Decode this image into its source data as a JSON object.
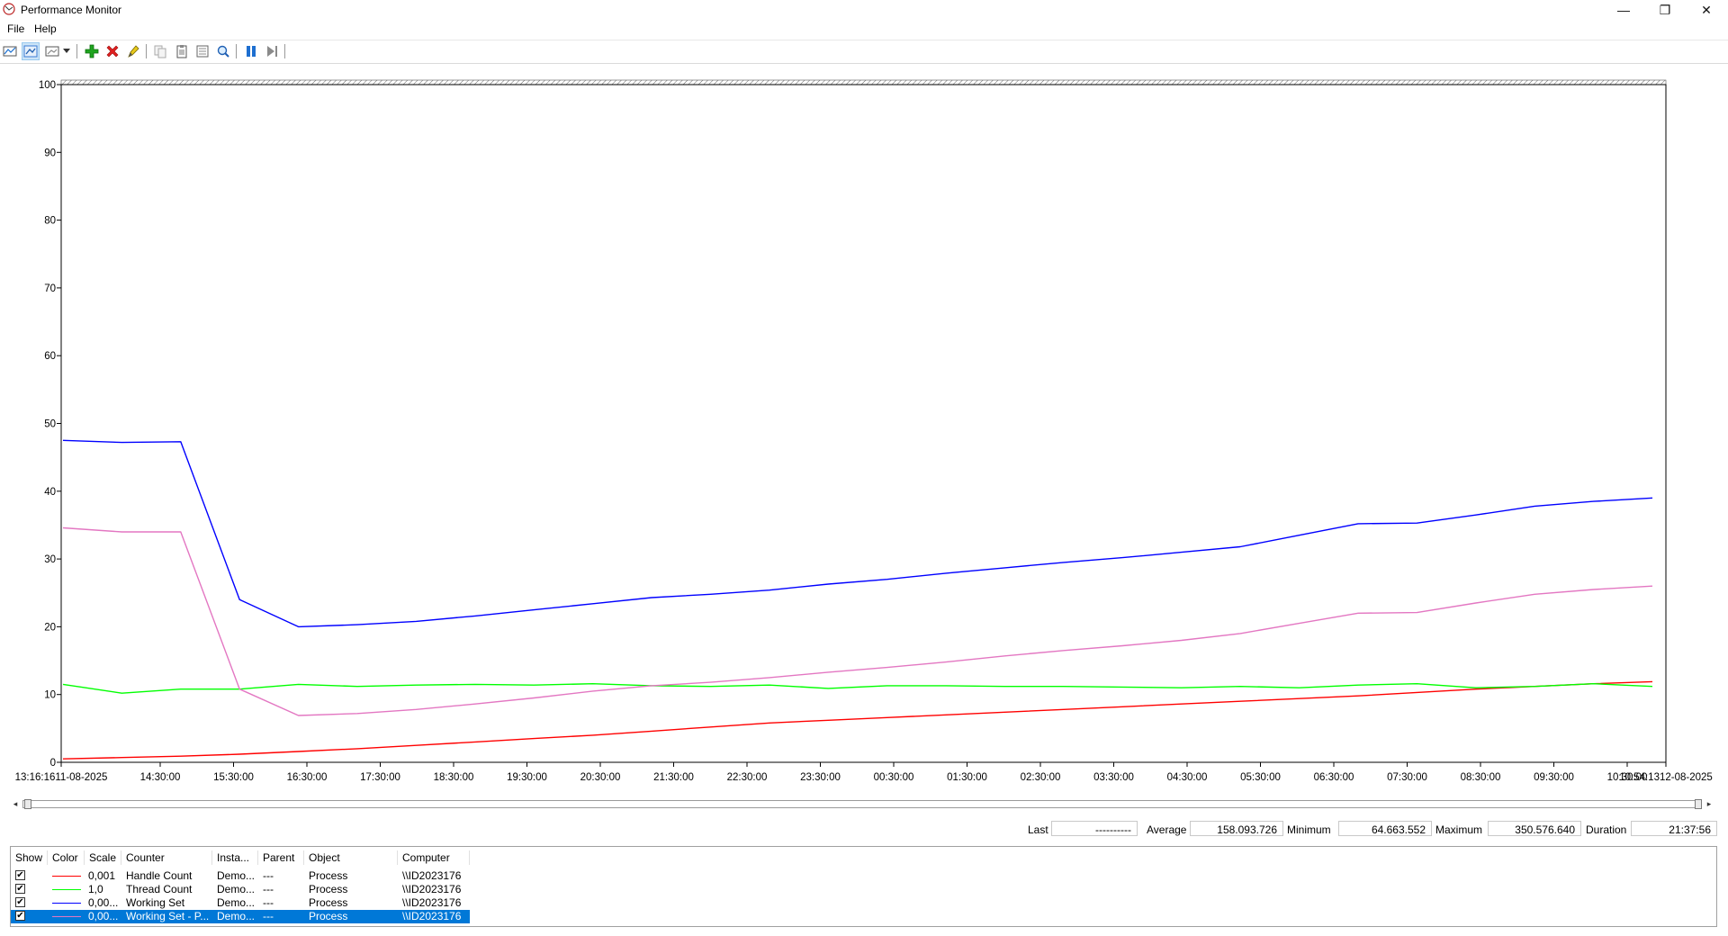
{
  "window": {
    "title": "Performance Monitor",
    "controls": {
      "minimize": "—",
      "restore": "❐",
      "close": "✕"
    }
  },
  "menu": {
    "file_label": "File",
    "help_label": "Help"
  },
  "toolbar": {
    "icons": [
      "view-current-activity-icon",
      "view-log-data-icon",
      "change-graph-type-icon",
      "dropdown-icon",
      "add-counter-icon",
      "delete-counter-icon",
      "highlight-icon",
      "copy-properties-icon",
      "paste-counter-list-icon",
      "properties-icon",
      "zoom-icon",
      "freeze-display-icon",
      "update-data-icon"
    ]
  },
  "colors": {
    "handle_count": "#ff0000",
    "thread_count": "#00ff00",
    "working_set": "#0000ff",
    "working_set_private": "#e377c2",
    "selection": "#0078d7"
  },
  "chart_data": {
    "type": "line",
    "ylim": [
      0,
      100
    ],
    "y_ticks": [
      "0",
      "10",
      "20",
      "30",
      "40",
      "50",
      "60",
      "70",
      "80",
      "90",
      "100"
    ],
    "x_tick_labels": [
      "13:16:1611-08-2025",
      "14:30:00",
      "15:30:00",
      "16:30:00",
      "17:30:00",
      "18:30:00",
      "19:30:00",
      "20:30:00",
      "21:30:00",
      "22:30:00",
      "23:30:00",
      "00:30:00",
      "01:30:00",
      "02:30:00",
      "03:30:00",
      "04:30:00",
      "05:30:00",
      "06:30:00",
      "07:30:00",
      "08:30:00",
      "09:30:00",
      "10:30:00",
      "10:54:1312-08-2025"
    ],
    "grid": false,
    "series": [
      {
        "name": "Handle Count",
        "color": "#ff0000",
        "values": [
          0.5,
          0.7,
          0.9,
          1.2,
          1.6,
          2.0,
          2.5,
          3.0,
          3.5,
          4.0,
          4.6,
          5.2,
          5.8,
          6.2,
          6.6,
          7.0,
          7.4,
          7.8,
          8.2,
          8.6,
          9.0,
          9.4,
          9.8,
          10.3,
          10.8,
          11.2,
          11.6,
          11.9
        ]
      },
      {
        "name": "Thread Count",
        "color": "#00ff00",
        "values": [
          11.5,
          10.2,
          10.8,
          10.8,
          11.5,
          11.2,
          11.4,
          11.5,
          11.4,
          11.6,
          11.3,
          11.2,
          11.4,
          10.9,
          11.3,
          11.3,
          11.2,
          11.2,
          11.1,
          11.0,
          11.2,
          11.0,
          11.4,
          11.6,
          11.0,
          11.2,
          11.6,
          11.2
        ]
      },
      {
        "name": "Working Set",
        "color": "#0000ff",
        "values": [
          47.5,
          47.2,
          47.3,
          24.0,
          20.0,
          20.3,
          20.8,
          21.6,
          22.5,
          23.4,
          24.3,
          24.8,
          25.4,
          26.3,
          27.0,
          27.9,
          28.7,
          29.5,
          30.2,
          31.0,
          31.8,
          33.5,
          35.2,
          35.3,
          36.5,
          37.8,
          38.5,
          39.0
        ]
      },
      {
        "name": "Working Set - Private",
        "color": "#e377c2",
        "values": [
          34.6,
          34.0,
          34.0,
          10.8,
          6.9,
          7.2,
          7.8,
          8.6,
          9.5,
          10.5,
          11.3,
          11.8,
          12.5,
          13.3,
          14.0,
          14.8,
          15.7,
          16.5,
          17.2,
          18.0,
          19.0,
          20.5,
          22.0,
          22.1,
          23.5,
          24.8,
          25.5,
          26.0
        ]
      }
    ]
  },
  "stats": {
    "last_label": "Last",
    "last_value": "----------",
    "average_label": "Average",
    "average_value": "158.093.726",
    "minimum_label": "Minimum",
    "minimum_value": "64.663.552",
    "maximum_label": "Maximum",
    "maximum_value": "350.576.640",
    "duration_label": "Duration",
    "duration_value": "21:37:56"
  },
  "legend": {
    "headers": [
      "Show",
      "Color",
      "Scale",
      "Counter",
      "Insta...",
      "Parent",
      "Object",
      "Computer"
    ],
    "rows": [
      {
        "checked": "✔",
        "color": "#ff0000",
        "scale": "0,001",
        "counter": "Handle Count",
        "instance": "Demo...",
        "parent": "---",
        "object": "Process",
        "computer": "\\\\ID2023176"
      },
      {
        "checked": "✔",
        "color": "#00ff00",
        "scale": "1,0",
        "counter": "Thread Count",
        "instance": "Demo...",
        "parent": "---",
        "object": "Process",
        "computer": "\\\\ID2023176"
      },
      {
        "checked": "✔",
        "color": "#0000ff",
        "scale": "0,00...",
        "counter": "Working Set",
        "instance": "Demo...",
        "parent": "---",
        "object": "Process",
        "computer": "\\\\ID2023176"
      },
      {
        "checked": "✔",
        "color": "#e377c2",
        "scale": "0,00...",
        "counter": "Working Set - P...",
        "instance": "Demo...",
        "parent": "---",
        "object": "Process",
        "computer": "\\\\ID2023176"
      }
    ]
  },
  "scrollbar": {
    "left_arrow": "◂",
    "right_arrow": "▸"
  }
}
